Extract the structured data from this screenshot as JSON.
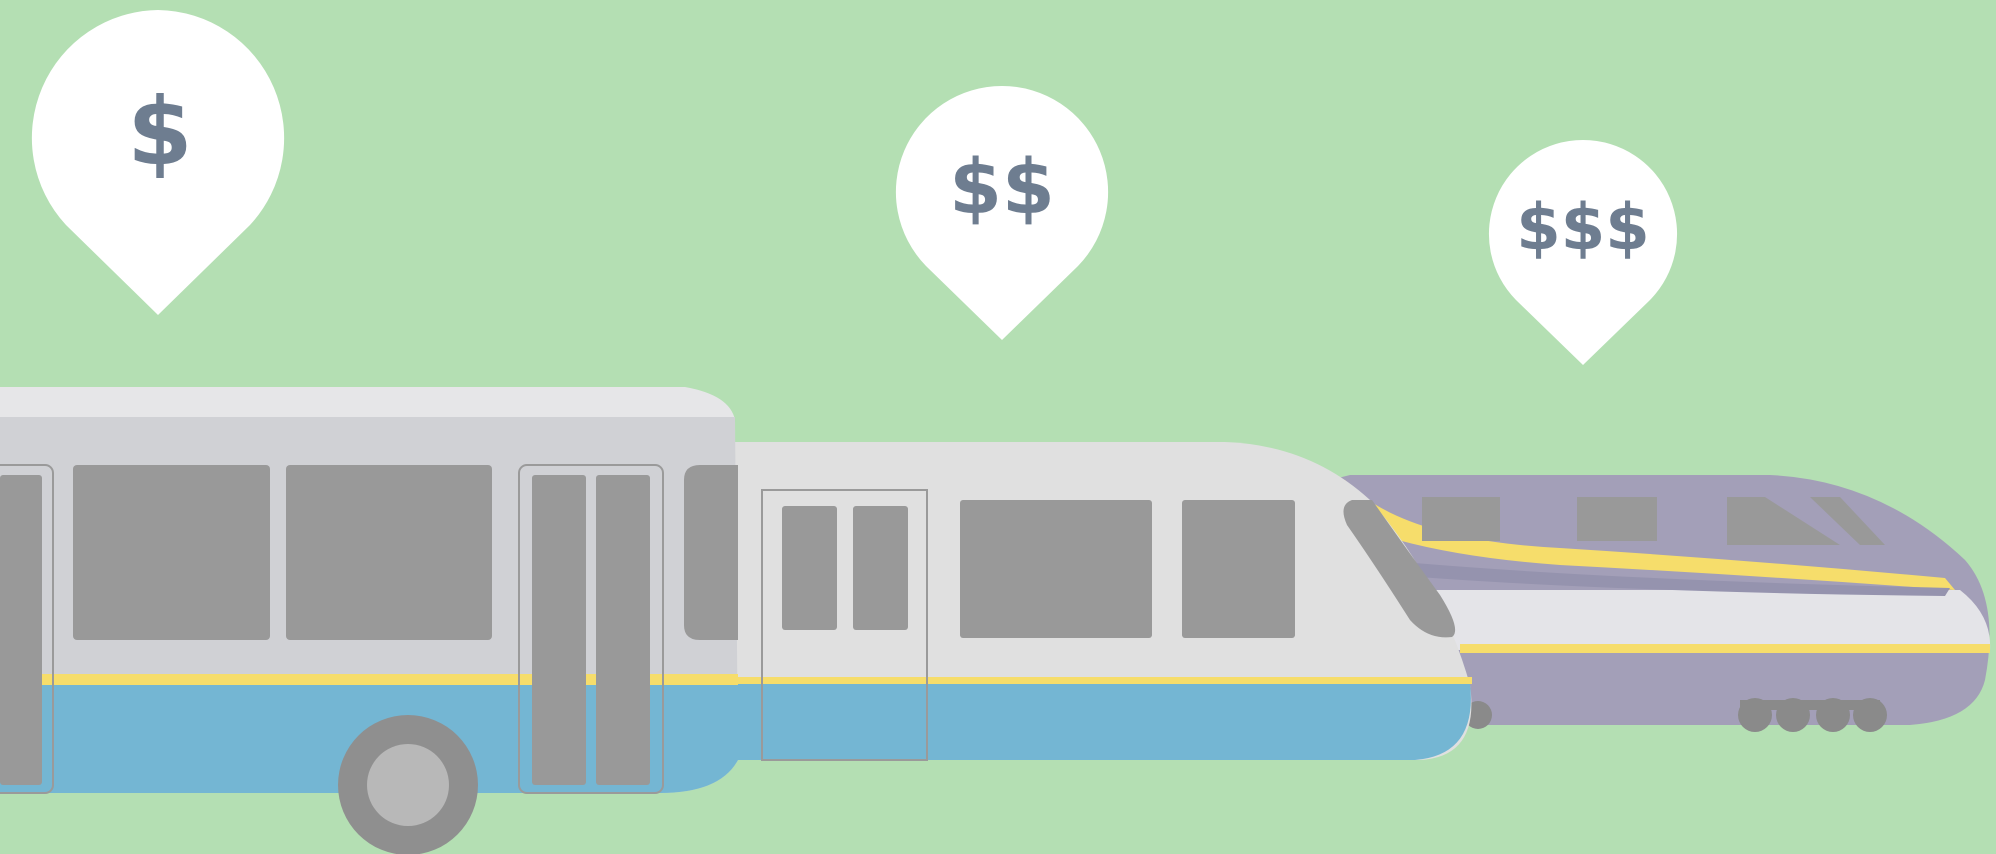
{
  "price_pins": [
    {
      "label": "$",
      "vehicle": "bus"
    },
    {
      "label": "$$",
      "vehicle": "light-rail"
    },
    {
      "label": "$$$",
      "vehicle": "high-speed-train"
    }
  ],
  "colors": {
    "background": "#b4dfb3",
    "pin": "#ffffff",
    "pin_text": "#6e7d90",
    "bus_body": "#d0d1d5",
    "bus_roof": "#e6e6e8",
    "vehicle_blue": "#74b6d3",
    "stripe_yellow": "#f6dd6b",
    "window_gray": "#999999",
    "rail_body": "#e0e0e0",
    "train_purple": "#a39fb8",
    "wheel_gray": "#8a8a8a"
  }
}
